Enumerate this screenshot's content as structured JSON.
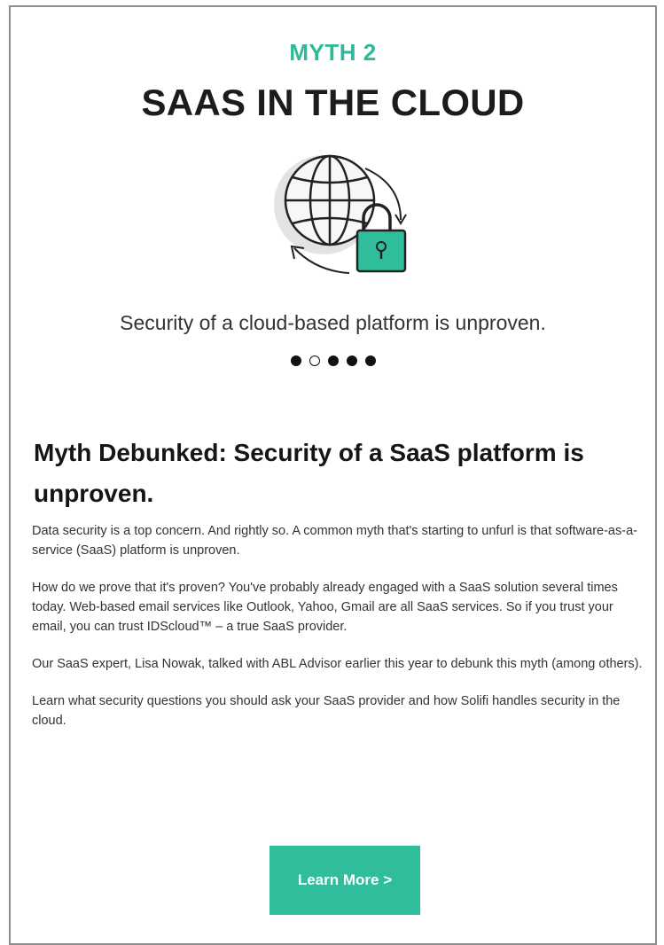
{
  "myth": {
    "eyebrow": "MYTH 2",
    "headline": "SAAS IN THE CLOUD",
    "icon": "globe-lock-icon",
    "tagline": "Security of a cloud-based platform is unproven."
  },
  "carousel": {
    "total_slides": 5,
    "active_slide": 2
  },
  "article": {
    "title": "Myth Debunked: Security of a SaaS platform is unproven.",
    "paragraphs": [
      "Data security is a top concern. And rightly so. A common myth that's starting to unfurl is that software-as-a-service (SaaS) platform is unproven.",
      "How do we prove that it's proven? You've probably already engaged with a SaaS solution several times today. Web-based email services like Outlook, Yahoo, Gmail are all SaaS services. So if you trust your email, you can trust IDScloud™ – a true SaaS provider.",
      "Our SaaS expert, Lisa Nowak, talked with ABL Advisor earlier this year to debunk this myth (among others).",
      "Learn what security questions you should ask your SaaS provider and how Solifi handles security in the cloud."
    ]
  },
  "cta": {
    "label": "Learn More >"
  },
  "colors": {
    "accent": "#2fb99a",
    "button": "#2fbd9c",
    "border": "#8d8d8d"
  }
}
